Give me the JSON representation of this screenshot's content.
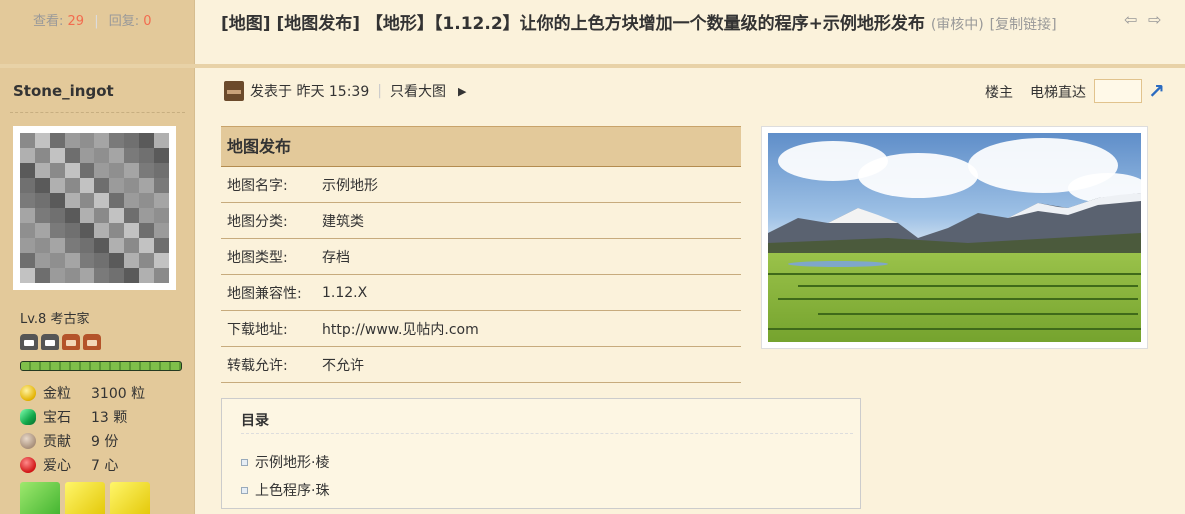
{
  "header": {
    "views_label": "查看:",
    "views": "29",
    "replies_label": "回复:",
    "replies": "0",
    "title": "[地图] [地图发布] 【地形】【1.12.2】让你的上色方块增加一个数量级的程序+示例地形发布",
    "status": "(审核中)",
    "copy_link": "[复制链接]",
    "prev_icon": "arrow-left-icon",
    "next_icon": "arrow-right-icon"
  },
  "author": {
    "name": "Stone_ingot",
    "level": "Lv.8 考古家",
    "xp_progress": 1.0,
    "credits": [
      {
        "label": "金粒",
        "value": "3100 粒",
        "icon": "gold-nugget-icon"
      },
      {
        "label": "宝石",
        "value": "13 颗",
        "icon": "emerald-icon"
      },
      {
        "label": "贡献",
        "value": "9 份",
        "icon": "contribution-icon"
      },
      {
        "label": "爱心",
        "value": "7 心",
        "icon": "apple-icon"
      }
    ]
  },
  "post": {
    "posted_label": "发表于",
    "posted_time": "昨天 15:39",
    "big_image_only": "只看大图",
    "op_label": "楼主",
    "elevator_label": "电梯直达",
    "jump_value": ""
  },
  "map_info": {
    "heading": "地图发布",
    "rows": [
      {
        "key": "地图名字:",
        "value": "示例地形"
      },
      {
        "key": "地图分类:",
        "value": "建筑类"
      },
      {
        "key": "地图类型:",
        "value": "存档"
      },
      {
        "key": "地图兼容性:",
        "value": "1.12.X"
      },
      {
        "key": "下载地址:",
        "value": "http://www.见帖内.com"
      },
      {
        "key": "转载允许:",
        "value": "不允许"
      }
    ]
  },
  "toc": {
    "title": "目录",
    "items": [
      "示例地形·棱",
      "上色程序·珠"
    ]
  }
}
